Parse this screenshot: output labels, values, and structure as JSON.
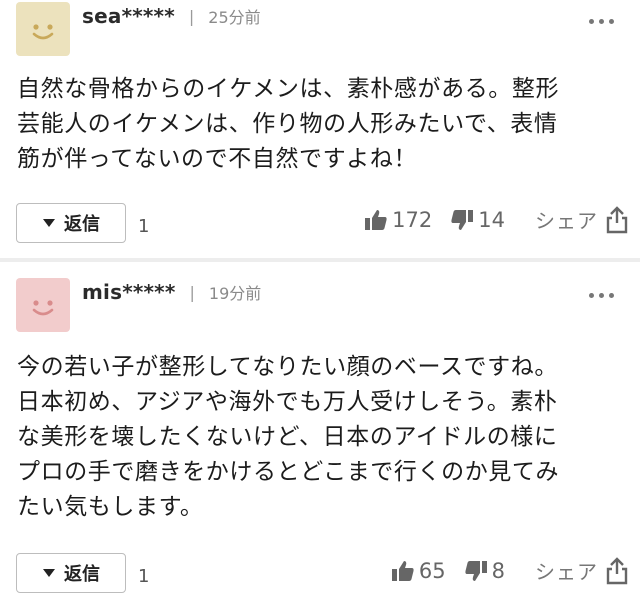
{
  "comments": [
    {
      "username": "sea*****",
      "separator": "|",
      "time": "25分前",
      "text": "自然な骨格からのイケメンは、素朴感がある。整形\n芸能人のイケメンは、作り物の人形みたいで、表情\n筋が伴ってないので不自然ですよね！",
      "reply_label": "返信",
      "reply_count": "1",
      "likes": "172",
      "dislikes": "14",
      "share_label": "シェア",
      "avatar_color": "#ece2bd"
    },
    {
      "username": "mis*****",
      "separator": "|",
      "time": "19分前",
      "text": "今の若い子が整形してなりたい顔のベースですね。\n日本初め、アジアや海外でも万人受けしそう。素朴\nな美形を壊したくないけど、日本のアイドルの様に\nプロの手で磨きをかけるとどこまで行くのか見てみ\nたい気もします。",
      "reply_label": "返信",
      "reply_count": "1",
      "likes": "65",
      "dislikes": "8",
      "share_label": "シェア",
      "avatar_color": "#f2cccc"
    }
  ],
  "icons": {
    "avatar": "smiley-face-icon",
    "reply_toggle": "caret-down-icon",
    "like": "thumbs-up-icon",
    "dislike": "thumbs-down-icon",
    "share": "share-icon",
    "more": "more-dots-icon"
  }
}
